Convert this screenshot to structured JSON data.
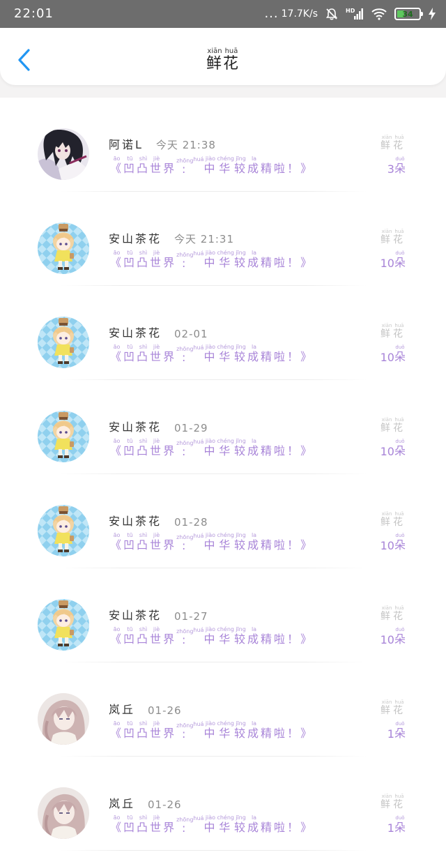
{
  "status_bar": {
    "time": "22:01",
    "dots": "...",
    "net_speed": "17.7K/s",
    "battery": "34",
    "hd_label": "HD"
  },
  "header": {
    "title": "鲜花",
    "title_pinyin": [
      "xiān",
      "huā"
    ]
  },
  "gift_line": {
    "text": "《凹凸世界: 中华较成精啦！》",
    "pinyin": [
      "āo",
      "tū",
      "shì",
      "jiè",
      "",
      "zhōng",
      "huá",
      "jiào",
      "chéng",
      "jīng",
      "la"
    ]
  },
  "gift_type": {
    "text": "鲜花",
    "pinyin": [
      "xiān",
      "huā"
    ]
  },
  "count_unit": {
    "text": "朵",
    "pinyin": "duǒ"
  },
  "items": [
    {
      "name": "阿诺L",
      "time": "今天 21:38",
      "count": "3",
      "avatar": "dark-hair"
    },
    {
      "name": "安山茶花",
      "time": "今天 21:31",
      "count": "10",
      "avatar": "chibi-blue"
    },
    {
      "name": "安山茶花",
      "time": "02-01",
      "count": "10",
      "avatar": "chibi-blue"
    },
    {
      "name": "安山茶花",
      "time": "01-29",
      "count": "10",
      "avatar": "chibi-blue"
    },
    {
      "name": "安山茶花",
      "time": "01-28",
      "count": "10",
      "avatar": "chibi-blue"
    },
    {
      "name": "安山茶花",
      "time": "01-27",
      "count": "10",
      "avatar": "chibi-blue"
    },
    {
      "name": "岚丘",
      "time": "01-26",
      "count": "1",
      "avatar": "pink-hair"
    },
    {
      "name": "岚丘",
      "time": "01-26",
      "count": "1",
      "avatar": "pink-hair"
    }
  ],
  "colors": {
    "accent_blue": "#2196f3",
    "gift_purple": "#a884d8",
    "status_bar": "#6d6d6d",
    "battery_green": "#5ec85e"
  }
}
